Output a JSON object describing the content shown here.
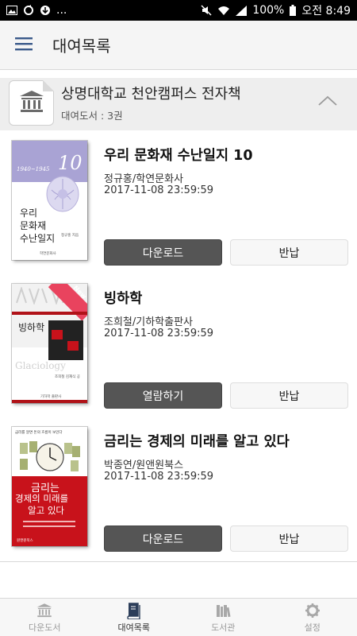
{
  "status_bar": {
    "battery": "100%",
    "time": "오전 8:49",
    "more": "..."
  },
  "app_bar": {
    "title": "대여목록",
    "menu_icon": "hamburger-menu-icon"
  },
  "library": {
    "name": "상명대학교 천안캠퍼스 전자책",
    "count": "대여도서 : 3권",
    "logo_icon": "museum-icon"
  },
  "books": [
    {
      "title": "우리 문화재 수난일지 10",
      "author": "정규홍/학연문화사",
      "due": "2017-11-08 23:59:59",
      "primary_label": "다운로드",
      "return_label": "반납",
      "cover": {
        "years": "1940~1945",
        "number": "10",
        "line1": "우리",
        "line2": "문화재",
        "line3": "수난일지",
        "small": "정규홍 지음",
        "publisher": "학연문화사"
      }
    },
    {
      "title": "빙하학",
      "author": "조희철/기하학출판사",
      "due": "2017-11-08 23:59:59",
      "primary_label": "열람하기",
      "return_label": "반납",
      "cover": {
        "badge": "New",
        "title": "빙하학",
        "subtitle": "Glaciology",
        "authors": "조희철 김재식 공",
        "publisher": "기하학 출판사"
      }
    },
    {
      "title": "금리는 경제의 미래를 알고 있다",
      "author": "박종연/원앤원북스",
      "due": "2017-11-08 23:59:59",
      "primary_label": "다운로드",
      "return_label": "반납",
      "cover": {
        "top": "금리를 알면 돈의 흐름이 보인다",
        "line1": "금리는",
        "line2": "경제의 미래를",
        "line3": "알고 있다",
        "publisher": "원앤원북스"
      }
    }
  ],
  "bottom_nav": [
    {
      "label": "다운도서",
      "icon": "museum-icon",
      "active": false
    },
    {
      "label": "대여목록",
      "icon": "books-icon",
      "active": true
    },
    {
      "label": "도서관",
      "icon": "library-shelf-icon",
      "active": false
    },
    {
      "label": "설정",
      "icon": "gear-icon",
      "active": false
    }
  ],
  "colors": {
    "primary_button": "#555555",
    "header_bg": "#eeeeee",
    "cover3_red": "#c8121b",
    "cover1_lavender": "#a9a3d4"
  }
}
